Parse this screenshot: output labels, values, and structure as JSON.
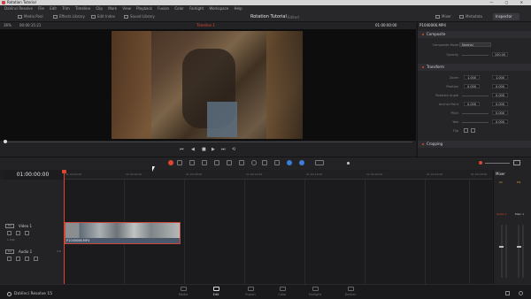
{
  "titlebar": {
    "title": "Rotation Tutorial",
    "win_buttons": "—  ▢  ✕"
  },
  "menu": [
    "DaVinci Resolve",
    "File",
    "Edit",
    "Trim",
    "Timeline",
    "Clip",
    "Mark",
    "View",
    "Playback",
    "Fusion",
    "Color",
    "Fairlight",
    "Workspace",
    "Help"
  ],
  "toolbar": {
    "media_pool": "Media Pool",
    "effects_library": "Effects Library",
    "edit_index": "Edit Index",
    "sound_library": "Sound Library",
    "project_title": "Rotation Tutorial",
    "project_sub": "Edited",
    "mixer": "Mixer",
    "metadata": "Metadata",
    "inspector": "Inspector"
  },
  "viewer": {
    "zoom": "36%",
    "timecode_left": "00:00:15:21",
    "clip_label": "Timeline 1",
    "timecode_right": "01:00:00:00",
    "playhead_fraction": 0.0
  },
  "transport": {
    "buttons": [
      "⏮",
      "◀",
      "■",
      "▶",
      "⏭",
      "⟲"
    ]
  },
  "inspector": {
    "filename": "P1040066.MP4",
    "composite": {
      "title": "Composite",
      "mode_label": "Composite Mode",
      "mode_value": "Normal",
      "opacity_label": "Opacity",
      "opacity_value": "100.00"
    },
    "transform": {
      "title": "Transform",
      "zoom_label": "Zoom",
      "zoom_x": "1.000",
      "zoom_y": "1.000",
      "position_label": "Position",
      "pos_x": "0.000",
      "pos_y": "0.000",
      "rotation_label": "Rotation Angle",
      "rotation": "0.000",
      "anchor_label": "Anchor Point",
      "anchor_x": "0.000",
      "anchor_y": "0.000",
      "pitch_label": "Pitch",
      "pitch": "0.000",
      "yaw_label": "Yaw",
      "yaw": "0.000",
      "flip_label": "Flip"
    },
    "cropping": {
      "title": "Cropping"
    }
  },
  "timeline": {
    "timecode": "01:00:00:00",
    "ruler": [
      "01:00:00:00",
      "01:00:04:00",
      "01:00:08:00",
      "01:00:12:00",
      "01:00:16:00",
      "01:00:20:00",
      "01:00:24:00",
      "01:00:28:00"
    ],
    "video_track": {
      "badge": "V1",
      "name": "Video 1",
      "clip_count": "1 Clip"
    },
    "audio_track": {
      "badge": "A1",
      "name": "Audio 1",
      "level": "2.0"
    },
    "clip": {
      "name": "P1040066.MP4"
    }
  },
  "mixer": {
    "title": "Mixer",
    "ch1": "Audio 1",
    "ch2": "Main 1",
    "a1": "A1",
    "m1": "M1"
  },
  "pages": [
    "Media",
    "Edit",
    "Fusion",
    "Color",
    "Fairlight",
    "Deliver"
  ],
  "active_page": "Edit",
  "brand": "DaVinci Resolve 15",
  "colors": {
    "accent_red": "#e0452f",
    "clip_blue": "#4b586b",
    "bg": "#1e1e20"
  }
}
